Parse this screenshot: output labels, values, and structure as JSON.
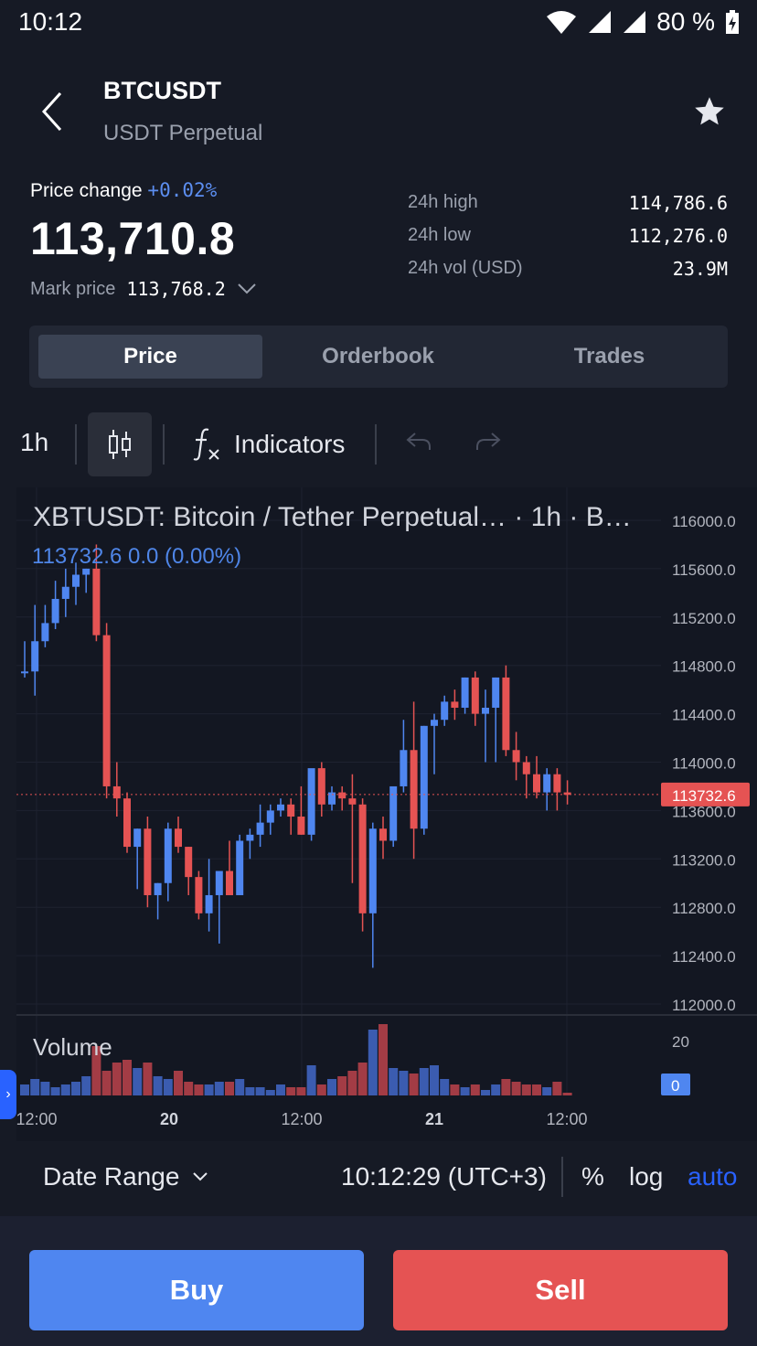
{
  "status": {
    "time": "10:12",
    "battery": "80 %"
  },
  "header": {
    "symbol": "BTCUSDT",
    "subtitle": "USDT Perpetual"
  },
  "stats": {
    "price_change_label": "Price change",
    "price_change_value": "+0.02%",
    "last_price": "113,710.8",
    "mark_label": "Mark price",
    "mark_value": "113,768.2",
    "high_label": "24h high",
    "high_value": "114,786.6",
    "low_label": "24h low",
    "low_value": "112,276.0",
    "vol_label": "24h vol (USD)",
    "vol_value": "23.9M"
  },
  "tabs": [
    "Price",
    "Orderbook",
    "Trades"
  ],
  "toolbar": {
    "interval": "1h",
    "indicators": "Indicators"
  },
  "chart_header": {
    "title": "XBTUSDT: Bitcoin / Tether Perpetual… · 1h · B…",
    "legend": "113732.6  0.0 (0.00%)",
    "volume_label": "Volume",
    "price_tag": "113732.6",
    "vol_tag": "0"
  },
  "bottom": {
    "date_range": "Date Range",
    "clock": "10:12:29 (UTC+3)",
    "percent": "%",
    "log": "log",
    "auto": "auto"
  },
  "actions": {
    "buy": "Buy",
    "sell": "Sell"
  },
  "colors": {
    "up": "#4f86f0",
    "down": "#e55353",
    "bg": "#131722",
    "accent": "#2962ff"
  },
  "chart_data": {
    "type": "candlestick",
    "y_ticks": [
      "116000.0",
      "115600.0",
      "115200.0",
      "114800.0",
      "114400.0",
      "114000.0",
      "113600.0",
      "113200.0",
      "112800.0",
      "112400.0",
      "112000.0"
    ],
    "ylim": [
      112000,
      116000
    ],
    "x_ticks": [
      "12:00",
      "20",
      "12:00",
      "21",
      "12:00"
    ],
    "volume_ticks": [
      "20"
    ],
    "last_price": 113732.6,
    "candles": [
      {
        "o": 114750,
        "h": 115000,
        "l": 114700,
        "c": 114750
      },
      {
        "o": 114750,
        "h": 115300,
        "l": 114550,
        "c": 115000
      },
      {
        "o": 115000,
        "h": 115300,
        "l": 114950,
        "c": 115150
      },
      {
        "o": 115150,
        "h": 115500,
        "l": 115100,
        "c": 115350
      },
      {
        "o": 115350,
        "h": 115600,
        "l": 115200,
        "c": 115450
      },
      {
        "o": 115450,
        "h": 115650,
        "l": 115300,
        "c": 115550
      },
      {
        "o": 115550,
        "h": 115600,
        "l": 115400,
        "c": 115600
      },
      {
        "o": 115600,
        "h": 115800,
        "l": 115000,
        "c": 115050
      },
      {
        "o": 115050,
        "h": 115150,
        "l": 113700,
        "c": 113800
      },
      {
        "o": 113800,
        "h": 114000,
        "l": 113550,
        "c": 113700
      },
      {
        "o": 113700,
        "h": 113750,
        "l": 113250,
        "c": 113300
      },
      {
        "o": 113300,
        "h": 113450,
        "l": 112950,
        "c": 113450
      },
      {
        "o": 113450,
        "h": 113550,
        "l": 112800,
        "c": 112900
      },
      {
        "o": 112900,
        "h": 113000,
        "l": 112700,
        "c": 113000
      },
      {
        "o": 113000,
        "h": 113500,
        "l": 112850,
        "c": 113450
      },
      {
        "o": 113450,
        "h": 113550,
        "l": 113250,
        "c": 113300
      },
      {
        "o": 113300,
        "h": 113300,
        "l": 112900,
        "c": 113050
      },
      {
        "o": 113050,
        "h": 113100,
        "l": 112700,
        "c": 112750
      },
      {
        "o": 112750,
        "h": 113200,
        "l": 112600,
        "c": 112900
      },
      {
        "o": 112900,
        "h": 113050,
        "l": 112500,
        "c": 113100
      },
      {
        "o": 113100,
        "h": 113350,
        "l": 112900,
        "c": 112900
      },
      {
        "o": 112900,
        "h": 113400,
        "l": 112900,
        "c": 113350
      },
      {
        "o": 113350,
        "h": 113450,
        "l": 113200,
        "c": 113400
      },
      {
        "o": 113400,
        "h": 113650,
        "l": 113300,
        "c": 113500
      },
      {
        "o": 113500,
        "h": 113650,
        "l": 113400,
        "c": 113600
      },
      {
        "o": 113600,
        "h": 113700,
        "l": 113550,
        "c": 113650
      },
      {
        "o": 113650,
        "h": 113700,
        "l": 113400,
        "c": 113550
      },
      {
        "o": 113550,
        "h": 113800,
        "l": 113400,
        "c": 113400
      },
      {
        "o": 113400,
        "h": 113850,
        "l": 113350,
        "c": 113950
      },
      {
        "o": 113950,
        "h": 114000,
        "l": 113550,
        "c": 113650
      },
      {
        "o": 113650,
        "h": 113800,
        "l": 113600,
        "c": 113750
      },
      {
        "o": 113750,
        "h": 113800,
        "l": 113600,
        "c": 113700
      },
      {
        "o": 113700,
        "h": 113900,
        "l": 113000,
        "c": 113650
      },
      {
        "o": 113650,
        "h": 113700,
        "l": 112600,
        "c": 112750
      },
      {
        "o": 112750,
        "h": 113500,
        "l": 112300,
        "c": 113450
      },
      {
        "o": 113450,
        "h": 113550,
        "l": 113200,
        "c": 113350
      },
      {
        "o": 113350,
        "h": 113600,
        "l": 113300,
        "c": 113800
      },
      {
        "o": 113800,
        "h": 114350,
        "l": 113750,
        "c": 114100
      },
      {
        "o": 114100,
        "h": 114500,
        "l": 113200,
        "c": 113450
      },
      {
        "o": 113450,
        "h": 114300,
        "l": 113400,
        "c": 114300
      },
      {
        "o": 114300,
        "h": 114400,
        "l": 113900,
        "c": 114350
      },
      {
        "o": 114350,
        "h": 114550,
        "l": 114300,
        "c": 114500
      },
      {
        "o": 114500,
        "h": 114600,
        "l": 114350,
        "c": 114450
      },
      {
        "o": 114450,
        "h": 114700,
        "l": 114400,
        "c": 114700
      },
      {
        "o": 114700,
        "h": 114750,
        "l": 114300,
        "c": 114400
      },
      {
        "o": 114400,
        "h": 114600,
        "l": 114000,
        "c": 114450
      },
      {
        "o": 114450,
        "h": 114700,
        "l": 114000,
        "c": 114700
      },
      {
        "o": 114700,
        "h": 114800,
        "l": 114050,
        "c": 114100
      },
      {
        "o": 114100,
        "h": 114250,
        "l": 113850,
        "c": 114000
      },
      {
        "o": 114000,
        "h": 114050,
        "l": 113700,
        "c": 113900
      },
      {
        "o": 113900,
        "h": 114050,
        "l": 113700,
        "c": 113750
      },
      {
        "o": 113750,
        "h": 113950,
        "l": 113600,
        "c": 113900
      },
      {
        "o": 113900,
        "h": 113950,
        "l": 113600,
        "c": 113750
      },
      {
        "o": 113750,
        "h": 113850,
        "l": 113650,
        "c": 113730
      }
    ],
    "volumes": [
      4,
      6,
      5,
      3,
      4,
      5,
      7,
      18,
      9,
      12,
      13,
      10,
      12,
      7,
      6,
      9,
      5,
      4,
      4,
      5,
      5,
      6,
      3,
      3,
      2,
      4,
      3,
      3,
      11,
      4,
      6,
      7,
      9,
      12,
      24,
      26,
      10,
      9,
      8,
      10,
      11,
      6,
      4,
      3,
      4,
      2,
      4,
      6,
      5,
      4,
      4,
      3,
      5,
      1
    ]
  }
}
